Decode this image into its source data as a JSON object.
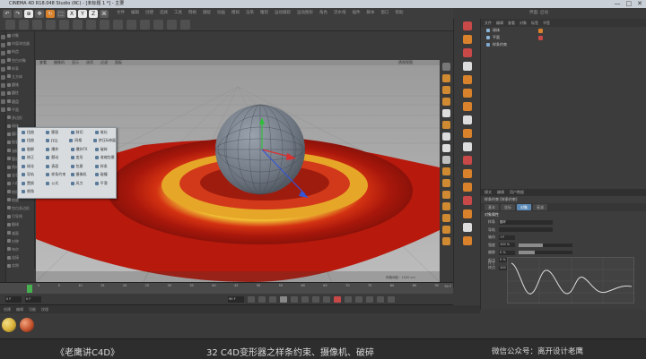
{
  "window": {
    "title": "CINEMA 4D R18.048 Studio (RC) - [未标题 1 *] - 主要",
    "controls": [
      "—",
      "□",
      "✕"
    ]
  },
  "menubar": {
    "tool_icons": [
      "↶",
      "↷",
      "⊕",
      "✥",
      "↻",
      "⬚",
      "X",
      "Y",
      "Z",
      "⌘"
    ],
    "menus": [
      "文件",
      "编辑",
      "创建",
      "选择",
      "工具",
      "网格",
      "捕捉",
      "动画",
      "模拟",
      "渲染",
      "雕刻",
      "运动跟踪",
      "运动图形",
      "角色",
      "流水线",
      "插件",
      "脚本",
      "窗口",
      "帮助"
    ],
    "layout_label": "界面: 启动"
  },
  "left_list": {
    "items": [
      "对象",
      "内容浏览器",
      "构造",
      "空白对象",
      "样条",
      "立方体",
      "圆锥",
      "圆柱",
      "圆盘",
      "平面",
      "多边形",
      "球体",
      "圆环",
      "胶囊",
      "油桶",
      "管道",
      "角锥",
      "宝石",
      "人偶",
      "地形",
      "地貌",
      "空白多边形",
      "引导线",
      "融球",
      "减面",
      "对称",
      "布尔",
      "连接",
      "实例"
    ]
  },
  "viewport": {
    "menu": [
      "查看",
      "摄像机",
      "显示",
      "选项",
      "过滤",
      "面板"
    ],
    "label": "透视视图",
    "grid_label": "网格间距 : 1000 cm"
  },
  "popup_menu": {
    "rows": [
      [
        "扭曲",
        "膨胀",
        "斜切",
        "锥化"
      ],
      [
        "扭曲",
        "FFD",
        "网格",
        "挤压&伸展"
      ],
      [
        "融解",
        "爆炸",
        "爆炸FX",
        "破碎"
      ],
      [
        "修正",
        "颤动",
        "变形",
        "收缩包裹"
      ],
      [
        "球化",
        "表面",
        "包裹",
        "样条"
      ],
      [
        "导轨",
        "样条约束",
        "摄像机",
        "碰撞"
      ],
      [
        "置换",
        "公式",
        "风力",
        "平滑"
      ],
      [
        "倒角"
      ]
    ]
  },
  "object_manager": {
    "menu": [
      "文件",
      "编辑",
      "查看",
      "对象",
      "标签",
      "书签"
    ],
    "objects": [
      {
        "name": "球体",
        "tag_color": "#d9822b"
      },
      {
        "name": "平面",
        "tag_color": "#c94848"
      },
      {
        "name": "样条约束",
        "tag_color": "#7fa7d0"
      }
    ]
  },
  "attribute_manager": {
    "menu": [
      "模式",
      "编辑",
      "用户数据"
    ],
    "object_label": "样条约束 [样条约束]",
    "tabs": [
      "基本",
      "坐标",
      "对象",
      "衰减"
    ],
    "active_tab": "对象",
    "section": "对象属性",
    "fields": [
      {
        "label": "样条",
        "value": "圆环"
      },
      {
        "label": "导轨",
        "value": ""
      },
      {
        "label": "轴向",
        "value": "+Y"
      },
      {
        "label": "强度",
        "value": "100 %",
        "level": 0.45
      },
      {
        "label": "偏移",
        "value": "0 %",
        "level": 0.3
      },
      {
        "label": "起点",
        "value": "0 %",
        "level": 0.0
      },
      {
        "label": "终点",
        "value": "100 %",
        "level": 0.55
      }
    ],
    "graph_label": "尺寸"
  },
  "timeline": {
    "ticks": [
      "0",
      "5",
      "10",
      "15",
      "20",
      "25",
      "30",
      "35",
      "40",
      "45",
      "50",
      "55",
      "60",
      "65",
      "70",
      "75",
      "80",
      "85",
      "90"
    ],
    "current_frame": "0 F",
    "end_frame": "90 F",
    "start_field": "0 F",
    "end_field": "90 F"
  },
  "materials": {
    "menu": [
      "创建",
      "编辑",
      "功能",
      "纹理"
    ],
    "items": [
      {
        "name": "材质",
        "color": "#d8b13a"
      },
      {
        "name": "材质.1",
        "color": "#c4532d"
      }
    ]
  },
  "caption": {
    "left": "《老鹰讲C4D》",
    "center": "32 C4D变形器之样条约束、摄像机、破碎",
    "right": "微信公众号：离开设计老鹰"
  },
  "colors": {
    "accent": "#5b8ab8",
    "plane_red": "#c42a14",
    "plane_yellow": "#e8c23a",
    "sphere": "#7c8590"
  }
}
